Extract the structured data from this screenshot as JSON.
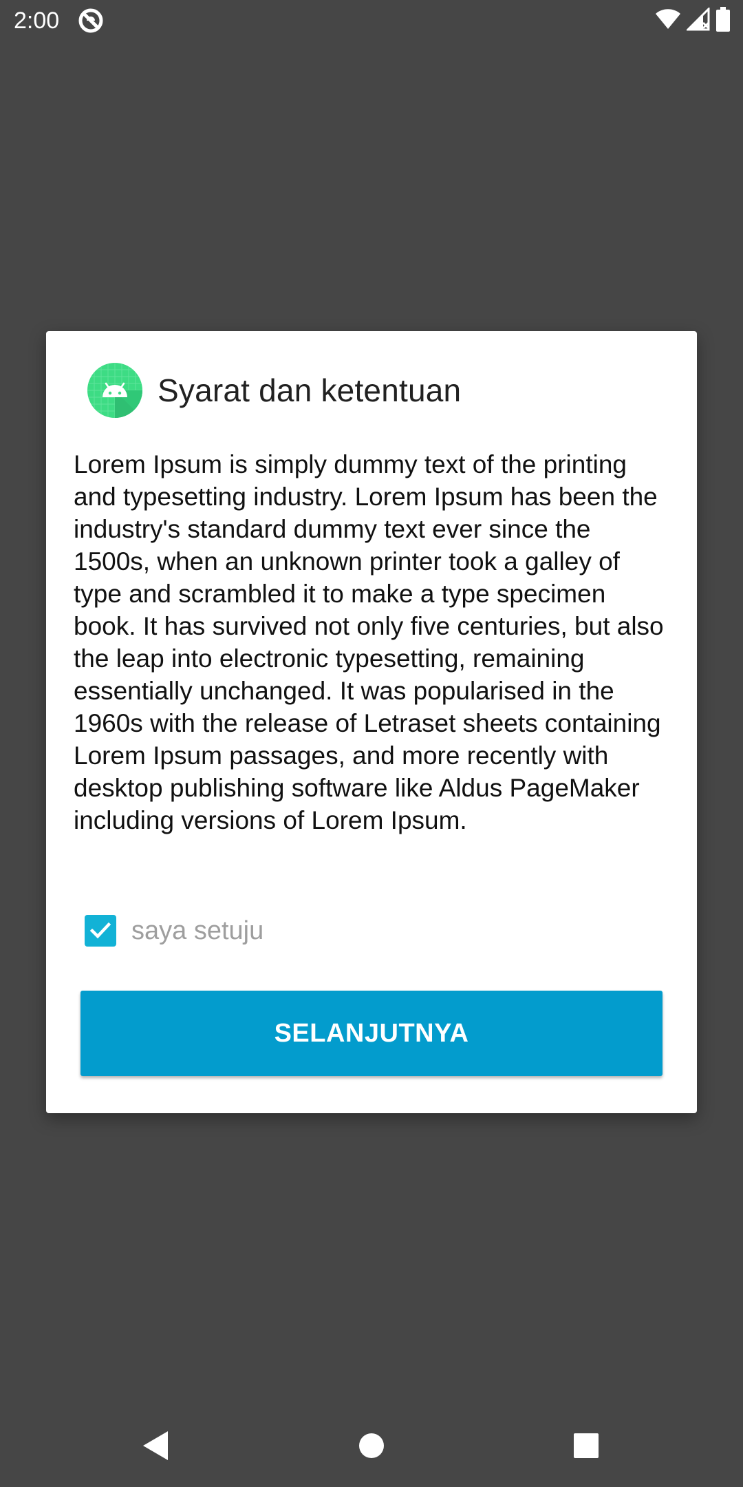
{
  "status_bar": {
    "time": "2:00",
    "icons": [
      "app-notification-icon",
      "wifi-icon",
      "cellular-signal-icon",
      "battery-icon"
    ]
  },
  "dialog": {
    "icon": "android-icon",
    "title": "Syarat dan ketentuan",
    "body": "Lorem Ipsum is simply dummy text of the printing and typesetting industry. Lorem Ipsum has been the industry's standard dummy text ever since the 1500s, when an unknown printer took a galley of type and scrambled it to make a type specimen book. It has survived not only five centuries, but also the leap into electronic typesetting, remaining essentially unchanged. It was popularised in the 1960s with the release of Letraset sheets containing Lorem Ipsum passages, and more recently with desktop publishing software like Aldus PageMaker including versions of Lorem Ipsum.",
    "agree_checkbox": {
      "label": "saya setuju",
      "checked": true
    },
    "next_button_label": "SELANJUTNYA"
  },
  "nav_bar": {
    "buttons": [
      "back-icon",
      "home-icon",
      "recents-icon"
    ]
  },
  "colors": {
    "background": "#464646",
    "accent": "#039ccd",
    "checkbox": "#12b2d6",
    "android_green": "#3ddc84"
  }
}
